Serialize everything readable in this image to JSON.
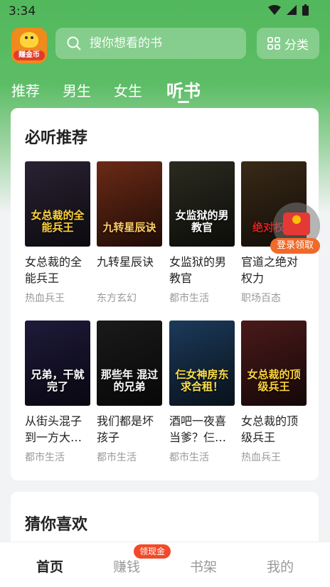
{
  "status_bar": {
    "time": "3:34"
  },
  "app_logo": {
    "badge": "赚金币"
  },
  "search": {
    "placeholder": "搜你想看的书"
  },
  "category_button": {
    "label": "分类"
  },
  "tabs": [
    {
      "label": "推荐"
    },
    {
      "label": "男生"
    },
    {
      "label": "女生"
    },
    {
      "label": "听书",
      "active": true
    }
  ],
  "must_listen": {
    "title": "必听推荐",
    "books": [
      {
        "title": "女总裁的全能兵王",
        "category": "热血兵王",
        "cover_text": "女总裁的全能兵王",
        "cover_bg": "#2a2233",
        "cover_fg": "#ffd23a"
      },
      {
        "title": "九转星辰诀",
        "category": "东方玄幻",
        "cover_text": "九转星辰诀",
        "cover_bg": "#6b2a16",
        "cover_fg": "#ffcc66"
      },
      {
        "title": "女监狱的男教官",
        "category": "都市生活",
        "cover_text": "女监狱的男教官",
        "cover_bg": "#2b2b20",
        "cover_fg": "#ffffff"
      },
      {
        "title": "官道之绝对权力",
        "category": "职场百态",
        "cover_text": "绝对权力",
        "cover_bg": "#3a2a18",
        "cover_fg": "#e02020"
      },
      {
        "title": "从街头混子到一方大…",
        "category": "都市生活",
        "cover_text": "兄弟，干就完了",
        "cover_bg": "#1e1a3a",
        "cover_fg": "#ffffff"
      },
      {
        "title": "我们都是坏孩子",
        "category": "都市生活",
        "cover_text": "那些年 混过的兄弟",
        "cover_bg": "#1a1a1a",
        "cover_fg": "#ffffff"
      },
      {
        "title": "酒吧一夜喜当爹？仨…",
        "category": "都市生活",
        "cover_text": "仨女神房东求合租！",
        "cover_bg": "#1c3a5a",
        "cover_fg": "#ffe04a"
      },
      {
        "title": "女总裁的顶级兵王",
        "category": "热血兵王",
        "cover_text": "女总裁的顶级兵王",
        "cover_bg": "#4a1a1a",
        "cover_fg": "#ffd23a"
      }
    ]
  },
  "guess_you_like": {
    "title": "猜你喜欢"
  },
  "floating_reward": {
    "label": "登录领取"
  },
  "bottom_nav": {
    "items": [
      {
        "label": "首页",
        "active": true
      },
      {
        "label": "赚钱"
      },
      {
        "label": "书架"
      },
      {
        "label": "我的"
      }
    ],
    "badge": "领现金"
  },
  "colors": {
    "brand_green": "#5dbd66",
    "accent_red": "#e53935",
    "badge_orange": "#f04a2a"
  }
}
